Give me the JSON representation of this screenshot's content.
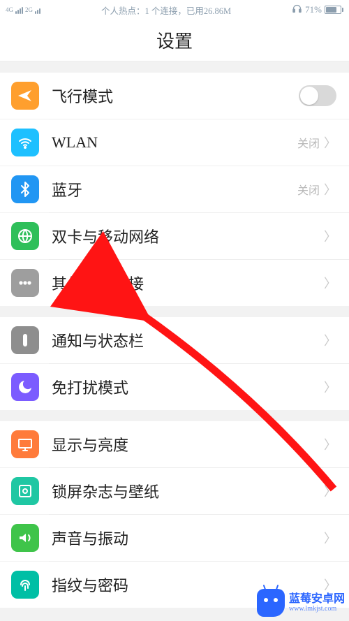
{
  "statusbar": {
    "signal_mode": "4G",
    "signal_sub": "2G",
    "hotspot_text": "个人热点：1 个连接，已用26.86M",
    "battery_pct": "71%"
  },
  "title": "设置",
  "groups": [
    {
      "items": [
        {
          "icon": "airplane",
          "icon_bg": "#ff9f2e",
          "label": "飞行模式",
          "kind": "toggle"
        },
        {
          "icon": "wifi",
          "icon_bg": "#1ec0ff",
          "label": "WLAN",
          "status": "关闭",
          "kind": "nav"
        },
        {
          "icon": "bluetooth",
          "icon_bg": "#2196f3",
          "label": "蓝牙",
          "status": "关闭",
          "kind": "nav"
        },
        {
          "icon": "globe",
          "icon_bg": "#2fbf5a",
          "label": "双卡与移动网络",
          "kind": "nav"
        },
        {
          "icon": "dots",
          "icon_bg": "#9e9e9e",
          "label": "其他无线连接",
          "kind": "nav"
        }
      ]
    },
    {
      "items": [
        {
          "icon": "notify",
          "icon_bg": "#8e8e8e",
          "label": "通知与状态栏",
          "kind": "nav"
        },
        {
          "icon": "dnd",
          "icon_bg": "#7b5cff",
          "label": "免打扰模式",
          "kind": "nav"
        }
      ]
    },
    {
      "items": [
        {
          "icon": "display",
          "icon_bg": "#ff7b3b",
          "label": "显示与亮度",
          "kind": "nav"
        },
        {
          "icon": "lock",
          "icon_bg": "#1fc7a3",
          "label": "锁屏杂志与壁纸",
          "kind": "nav"
        },
        {
          "icon": "sound",
          "icon_bg": "#3fc44a",
          "label": "声音与振动",
          "kind": "nav"
        },
        {
          "icon": "finger",
          "icon_bg": "#00bfa5",
          "label": "指纹与密码",
          "kind": "nav"
        }
      ]
    }
  ],
  "watermark": {
    "brand": "蓝莓安卓网",
    "url": "www.lmkjst.com"
  }
}
